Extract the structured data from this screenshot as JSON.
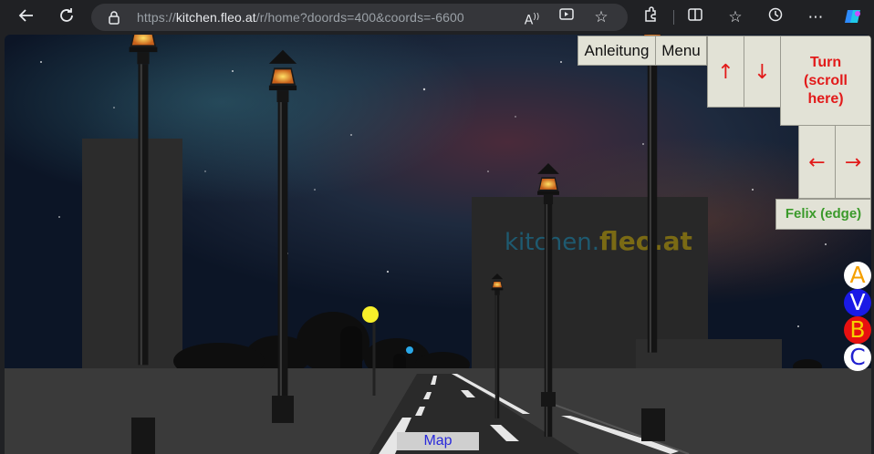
{
  "browser": {
    "url_prefix": "https://",
    "url_host": "kitchen.fleo.at",
    "url_path": "/r/home?doords=400&coords=-6600",
    "icons": [
      "back-icon",
      "reload-icon",
      "lock-icon",
      "read-aloud-icon",
      "media-icon",
      "favorite-star-icon",
      "extensions-icon",
      "split-screen-icon",
      "favorites-icon",
      "history-icon",
      "more-icon",
      "copilot-icon"
    ]
  },
  "scene": {
    "logo_prefix": "kitchen.",
    "logo_brand": "fleo.at"
  },
  "controls": {
    "anleitung": "Anleitung",
    "menu": "Menu",
    "up": "↑",
    "down": "↓",
    "turn": "Turn (scroll here)",
    "left": "←",
    "right": "→",
    "user": "Felix (edge)",
    "map": "Map"
  },
  "letters": [
    {
      "label": "A",
      "bg": "#ffffff",
      "fg": "#f5a000"
    },
    {
      "label": "V",
      "bg": "#1a1ae6",
      "fg": "#ffffff"
    },
    {
      "label": "B",
      "bg": "#e81010",
      "fg": "#f5d000"
    },
    {
      "label": "C",
      "bg": "#ffffff",
      "fg": "#2020d0"
    }
  ],
  "colors": {
    "button_bg": "#e2e2d6",
    "arrow": "#e21a1a",
    "user_text": "#3a9a2a",
    "map_text": "#2a2adb",
    "logo_blue": "#1e5a70",
    "logo_gold": "#7a6a14"
  }
}
